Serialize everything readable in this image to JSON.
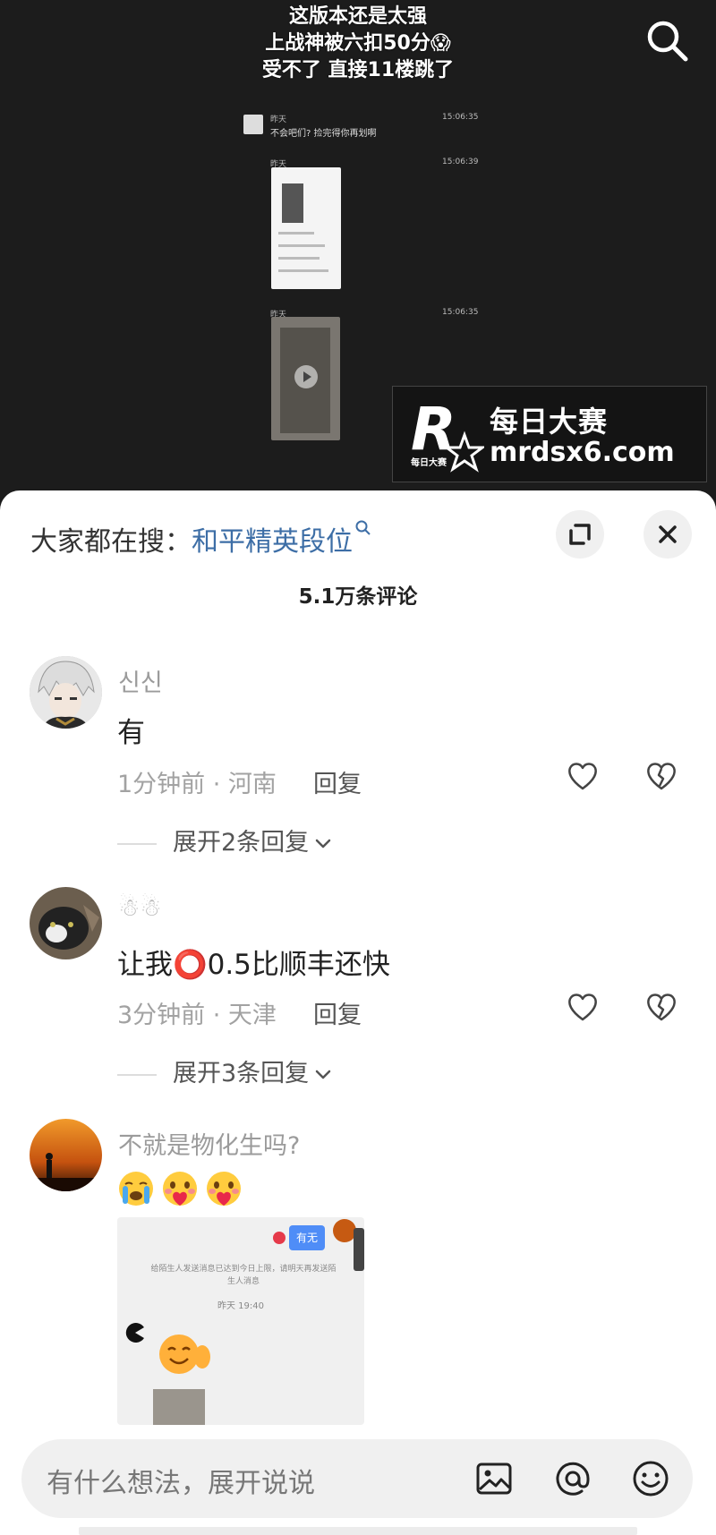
{
  "video": {
    "caption_lines": [
      "这版本还是太强",
      "上战神被六扣50分😱",
      "受不了    直接11楼跳了"
    ],
    "watermark": {
      "logo_letter": "R",
      "logo_small": "每日大赛",
      "line1": "每日大赛",
      "line2": "mrdsx6.com"
    },
    "chat_rows": [
      {
        "name": "昨天",
        "text": "不会吧们? 捡完得你再划啊",
        "time": "15:06:35"
      },
      {
        "name": "昨天",
        "time": "15:06:39"
      },
      {
        "name": "昨天",
        "time": "15:06:35"
      }
    ]
  },
  "sheet": {
    "hot_search_prefix": "大家都在搜：",
    "hot_search_term": "和平精英段位",
    "comment_count": "5.1万条评论"
  },
  "comments": [
    {
      "user": "신신",
      "text": "有",
      "meta": "1分钟前 · 河南",
      "reply_label": "回复",
      "expand_label": "展开2条回复"
    },
    {
      "user": "☃☃",
      "text": "让我⭕0.5比顺丰还快",
      "meta": "3分钟前 · 天津",
      "reply_label": "回复",
      "expand_label": "展开3条回复"
    },
    {
      "user": "不就是物化生吗?",
      "emojis": [
        "crying-face",
        "heart-face",
        "heart-face"
      ],
      "attachment": {
        "send_button": "有无",
        "notice": "给陌生人发送消息已达到今日上限，请明天再发送陌生人消息",
        "time": "昨天 19:40"
      }
    }
  ],
  "input_bar": {
    "placeholder": "有什么想法，展开说说"
  },
  "colors": {
    "accent_link": "#3d6ea6",
    "send_blue": "#4f8df7"
  }
}
